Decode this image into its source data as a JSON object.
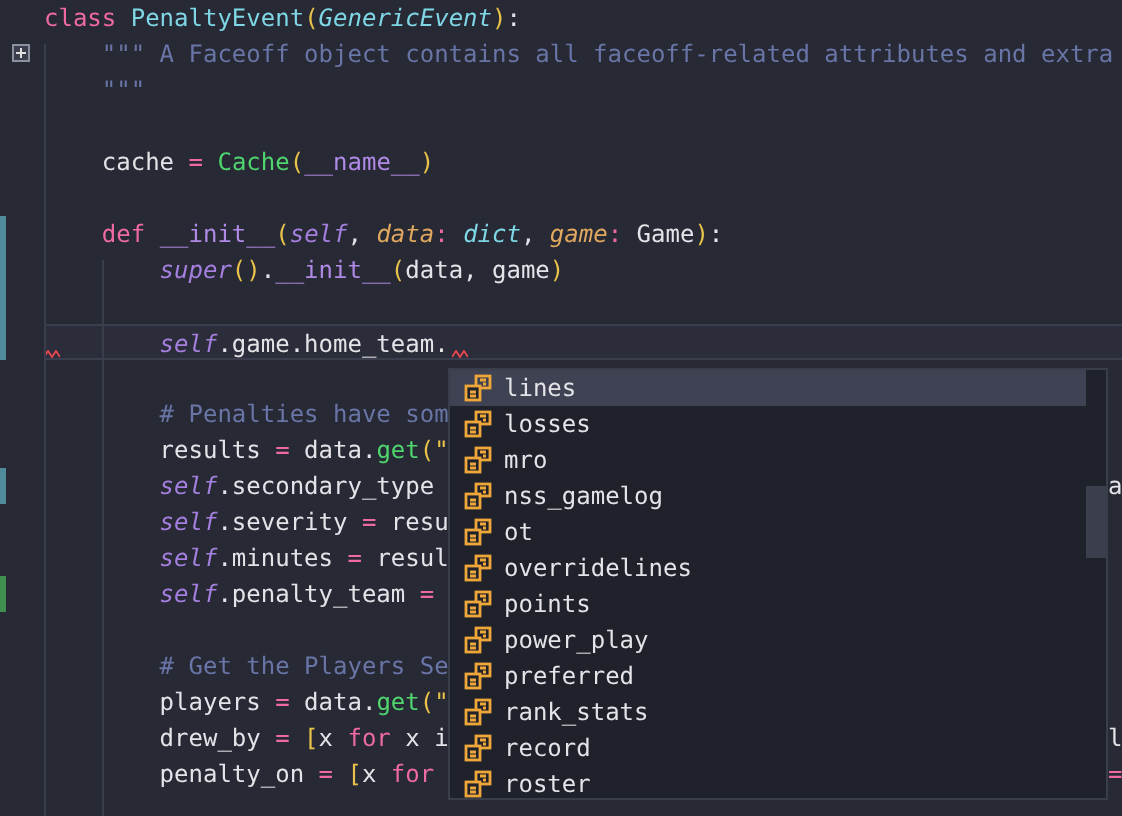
{
  "editor": {
    "lines": [
      {
        "kind": "code",
        "tokens": [
          {
            "text": "class ",
            "kind": "keyword"
          },
          {
            "text": "PenaltyEvent",
            "kind": "classname"
          },
          {
            "text": "(",
            "kind": "paren"
          },
          {
            "text": "GenericEvent",
            "kind": "type"
          },
          {
            "text": ")",
            "kind": "paren"
          },
          {
            "text": ":",
            "kind": "plain"
          }
        ]
      },
      {
        "kind": "code",
        "fold": true,
        "tokens": [
          {
            "text": "    \"\"\" A Faceoff object contains all faceoff-related attributes and extra",
            "kind": "comment"
          }
        ]
      },
      {
        "kind": "code",
        "tokens": [
          {
            "text": "    \"\"\"",
            "kind": "comment"
          }
        ]
      },
      {
        "kind": "blank"
      },
      {
        "kind": "code",
        "tokens": [
          {
            "text": "    cache ",
            "kind": "plain"
          },
          {
            "text": "= ",
            "kind": "keyword"
          },
          {
            "text": "Cache",
            "kind": "call"
          },
          {
            "text": "(",
            "kind": "paren"
          },
          {
            "text": "__name__",
            "kind": "dunder"
          },
          {
            "text": ")",
            "kind": "paren"
          }
        ]
      },
      {
        "kind": "blank"
      },
      {
        "kind": "code",
        "color": "#4f8b9a",
        "tokens": [
          {
            "text": "    def ",
            "kind": "keyword"
          },
          {
            "text": "__init__",
            "kind": "dunder"
          },
          {
            "text": "(",
            "kind": "paren"
          },
          {
            "text": "self",
            "kind": "self"
          },
          {
            "text": ", ",
            "kind": "plain"
          },
          {
            "text": "data",
            "kind": "param"
          },
          {
            "text": ": ",
            "kind": "keyword"
          },
          {
            "text": "dict",
            "kind": "type"
          },
          {
            "text": ", ",
            "kind": "plain"
          },
          {
            "text": "game",
            "kind": "param"
          },
          {
            "text": ": ",
            "kind": "keyword"
          },
          {
            "text": "Game",
            "kind": "plain"
          },
          {
            "text": ")",
            "kind": "paren"
          },
          {
            "text": ":",
            "kind": "plain"
          }
        ]
      },
      {
        "kind": "code",
        "color": "#4f8b9a",
        "tokens": [
          {
            "text": "        super",
            "kind": "self"
          },
          {
            "text": "()",
            "kind": "paren"
          },
          {
            "text": ".",
            "kind": "plain"
          },
          {
            "text": "__init__",
            "kind": "dunder"
          },
          {
            "text": "(",
            "kind": "paren"
          },
          {
            "text": "data, game",
            "kind": "plain"
          },
          {
            "text": ")",
            "kind": "paren"
          }
        ]
      },
      {
        "kind": "blank",
        "color": "#4f8b9a"
      },
      {
        "kind": "code",
        "color": "#4f8b9a",
        "current": true,
        "tokens": [
          {
            "text": "        self",
            "kind": "self"
          },
          {
            "text": ".game.home_team.",
            "kind": "plain"
          }
        ]
      },
      {
        "kind": "blank"
      },
      {
        "kind": "code",
        "tokens": [
          {
            "text": "        # Penalties have som",
            "kind": "comment"
          }
        ]
      },
      {
        "kind": "code",
        "tokens": [
          {
            "text": "        results ",
            "kind": "plain"
          },
          {
            "text": "=",
            "kind": "keyword"
          },
          {
            "text": " data.",
            "kind": "plain"
          },
          {
            "text": "get",
            "kind": "call"
          },
          {
            "text": "(",
            "kind": "paren"
          },
          {
            "text": "\"",
            "kind": "string"
          }
        ]
      },
      {
        "kind": "code",
        "color": "#4f8b9a",
        "tail": {
          "text": "a",
          "kind": "plain"
        },
        "tokens": [
          {
            "text": "        self",
            "kind": "self"
          },
          {
            "text": ".secondary_type",
            "kind": "plain"
          }
        ]
      },
      {
        "kind": "code",
        "tokens": [
          {
            "text": "        self",
            "kind": "self"
          },
          {
            "text": ".severity ",
            "kind": "plain"
          },
          {
            "text": "=",
            "kind": "keyword"
          },
          {
            "text": " resu",
            "kind": "plain"
          }
        ]
      },
      {
        "kind": "code",
        "tokens": [
          {
            "text": "        self",
            "kind": "self"
          },
          {
            "text": ".minutes ",
            "kind": "plain"
          },
          {
            "text": "=",
            "kind": "keyword"
          },
          {
            "text": " resul",
            "kind": "plain"
          }
        ]
      },
      {
        "kind": "code",
        "color": "#3f8f4f",
        "tokens": [
          {
            "text": "        self",
            "kind": "self"
          },
          {
            "text": ".penalty_team ",
            "kind": "plain"
          },
          {
            "text": "=",
            "kind": "keyword"
          }
        ]
      },
      {
        "kind": "blank"
      },
      {
        "kind": "code",
        "tokens": [
          {
            "text": "        # Get the Players Se",
            "kind": "comment"
          }
        ]
      },
      {
        "kind": "code",
        "tokens": [
          {
            "text": "        players ",
            "kind": "plain"
          },
          {
            "text": "=",
            "kind": "keyword"
          },
          {
            "text": " data.",
            "kind": "plain"
          },
          {
            "text": "get",
            "kind": "call"
          },
          {
            "text": "(",
            "kind": "paren"
          },
          {
            "text": "\"",
            "kind": "string"
          }
        ]
      },
      {
        "kind": "code",
        "tail": {
          "text": "l",
          "kind": "plain"
        },
        "tokens": [
          {
            "text": "        drew_by ",
            "kind": "plain"
          },
          {
            "text": "=",
            "kind": "keyword"
          },
          {
            "text": " [",
            "kind": "paren"
          },
          {
            "text": "x ",
            "kind": "plain"
          },
          {
            "text": "for",
            "kind": "keyword"
          },
          {
            "text": " x i",
            "kind": "plain"
          }
        ]
      },
      {
        "kind": "code",
        "tail": {
          "text": "=",
          "kind": "keyword"
        },
        "tokens": [
          {
            "text": "        penalty_on ",
            "kind": "plain"
          },
          {
            "text": "=",
            "kind": "keyword"
          },
          {
            "text": " [",
            "kind": "paren"
          },
          {
            "text": "x ",
            "kind": "plain"
          },
          {
            "text": "for",
            "kind": "keyword"
          }
        ]
      }
    ]
  },
  "completion": {
    "items": [
      {
        "label": "lines",
        "selected": true
      },
      {
        "label": "losses",
        "selected": false
      },
      {
        "label": "mro",
        "selected": false
      },
      {
        "label": "nss_gamelog",
        "selected": false
      },
      {
        "label": "ot",
        "selected": false
      },
      {
        "label": "overridelines",
        "selected": false
      },
      {
        "label": "points",
        "selected": false
      },
      {
        "label": "power_play",
        "selected": false
      },
      {
        "label": "preferred",
        "selected": false
      },
      {
        "label": "rank_stats",
        "selected": false
      },
      {
        "label": "record",
        "selected": false
      },
      {
        "label": "roster",
        "selected": false
      }
    ]
  }
}
